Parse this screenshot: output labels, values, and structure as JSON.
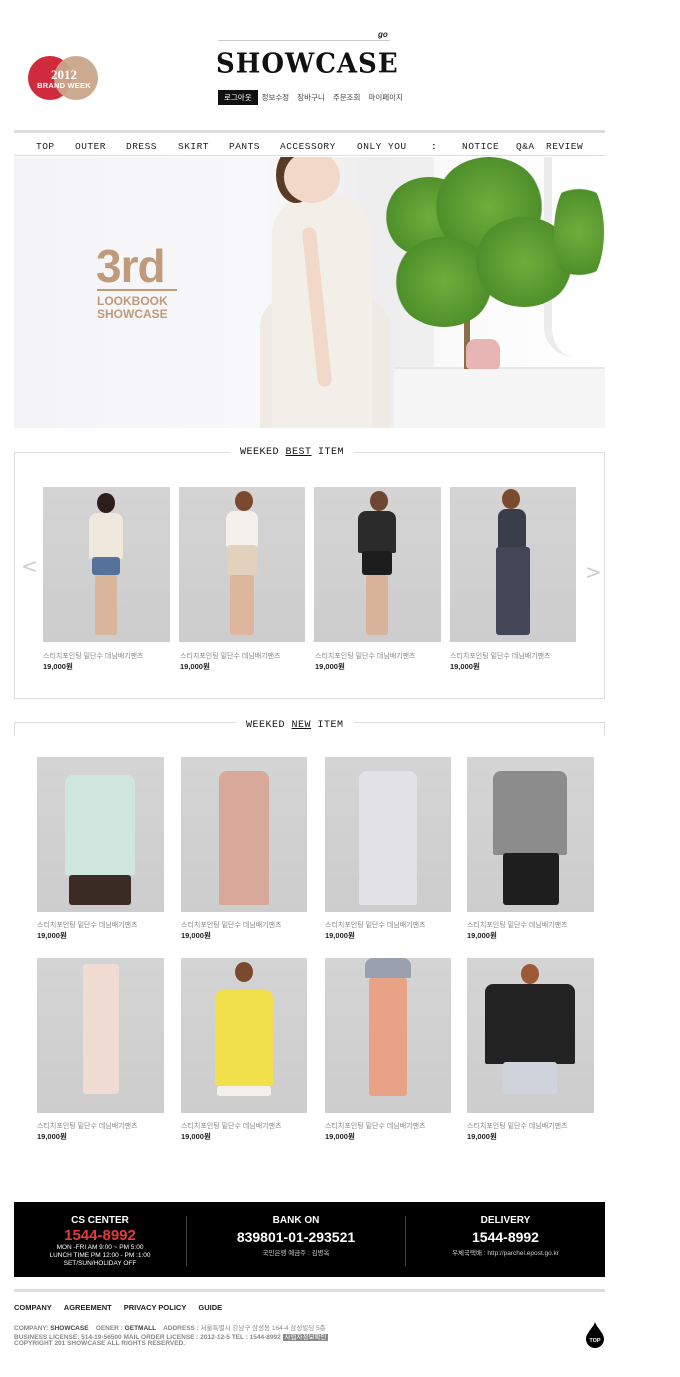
{
  "header": {
    "badge_year": "2012",
    "badge_text": "BRAND WEEK",
    "go_label": "go",
    "logo": "SHOWCASE",
    "user_nav": [
      "로그아웃",
      "정보수정",
      "장바구니",
      "주문조회",
      "마이페이지"
    ]
  },
  "nav": {
    "items": [
      "TOP",
      "OUTER",
      "DRESS",
      "SKIRT",
      "PANTS",
      "ACCESSORY",
      "ONLY YOU",
      ":",
      "NOTICE",
      "Q&A",
      "REVIEW"
    ]
  },
  "hero": {
    "title": "3rd",
    "line1": "LOOKBOOK",
    "line2": "SHOWCASE"
  },
  "best": {
    "title_pre": "WEEKED ",
    "title_ul": "BEST",
    "title_post": " ITEM",
    "prev_arrow": "<",
    "next_arrow": ">",
    "items": [
      {
        "name": "스티치포인팅 밑단수 데님배기팬츠",
        "price": "19,000원"
      },
      {
        "name": "스티치포인팅 밑단수 데님배기팬츠",
        "price": "19,000원"
      },
      {
        "name": "스티치포인팅 밑단수 데님배기팬츠",
        "price": "19,000원"
      },
      {
        "name": "스티치포인팅 밑단수 데님배기팬츠",
        "price": "19,000원"
      }
    ]
  },
  "new": {
    "title_pre": "WEEKED ",
    "title_ul": "NEW",
    "title_post": " ITEM",
    "items": [
      {
        "name": "스티치포인팅 밑단수 데님배기팬츠",
        "price": "19,000원"
      },
      {
        "name": "스티치포인팅 밑단수 데님배기팬츠",
        "price": "19,000원"
      },
      {
        "name": "스티치포인팅 밑단수 데님배기팬츠",
        "price": "19,000원"
      },
      {
        "name": "스티치포인팅 밑단수 데님배기팬츠",
        "price": "19,000원"
      },
      {
        "name": "스티치포인팅 밑단수 데님배기팬츠",
        "price": "19,000원"
      },
      {
        "name": "스티치포인팅 밑단수 데님배기팬츠",
        "price": "19,000원"
      },
      {
        "name": "스티치포인팅 밑단수 데님배기팬츠",
        "price": "19,000원"
      },
      {
        "name": "스티치포인팅 밑단수 데님배기팬츠",
        "price": "19,000원"
      }
    ]
  },
  "cs": {
    "cs_title": "CS CENTER",
    "cs_phone": "1544-8992",
    "cs_hours1": "MON -FRI AM 9:00 ~ PM 5:00",
    "cs_hours2": "LUNCH TIME PM 12:00 - PM :1:00",
    "cs_hours3": "SET/SUN/HOLIDAY OFF",
    "bank_title": "BANK ON",
    "bank_number": "839801-01-293521",
    "bank_info": "국민은행  예금주 : 김병옥",
    "delivery_title": "DELIVERY",
    "delivery_phone": "1544-8992",
    "delivery_info": "우체국택배 :  http://parchel.epost.go.kr"
  },
  "footer": {
    "links": [
      "COMPANY",
      "AGREEMENT",
      "PRIVACY POLICY",
      "GUIDE"
    ],
    "company_label": "COMPANY:",
    "company": "SHOWCASE",
    "owner_label": "OENER :",
    "owner": "GETMALL",
    "address_label": "ADDRESS :",
    "address": "서울특별시 강남구 삼성동 164-4 삼성빌딩 5층",
    "license_line": "BUSINESS LICENSE: 514-19-56500  MAIL ORDER LICENSE : 2012-12-5    TEL :  1544-8992",
    "license_button": "사업자정보확인",
    "copyright": "COPYRIGHT 201 SHOWCASE  ALL RIGHTS RESERVED.",
    "top_label": "TOP"
  },
  "colors": {
    "accent_red": "#d02a3d",
    "brand_tan": "#c09b7b",
    "footer_bg": "#000000",
    "phone_red": "#e23c3c"
  }
}
